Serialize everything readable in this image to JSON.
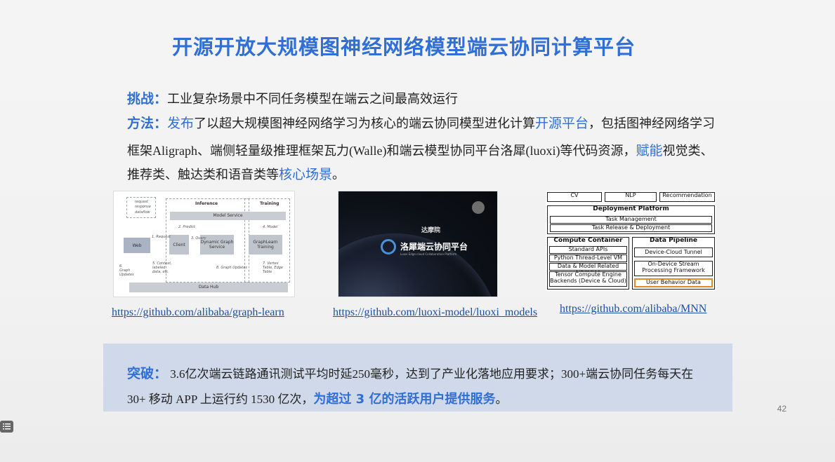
{
  "title": "开源开放大规模图神经网络模型端云协同计算平台",
  "challenge": {
    "label": "挑战：",
    "text": "工业复杂场景中不同任务模型在端云之间最高效运行"
  },
  "method": {
    "label": "方法：",
    "line1_a": "发布",
    "line1_b": "了以超大规模图神经网络学习为核心的端云协同模型进化计算",
    "line1_c": "开源平台",
    "line1_d": "，包括图神经网络学习",
    "line2_a": "框架Aligraph、端侧轻量级推理框架瓦力(Walle)和端云模型协同平台洛犀(luoxi)等代码资源，",
    "line2_b": "赋能",
    "line2_c": "视觉类、",
    "line3_a": "推荐类、触达类和语音类等",
    "line3_b": "核心场景",
    "line3_c": "。"
  },
  "figure1": {
    "inference": "Inference",
    "training": "Training",
    "model_service": "Model Service",
    "web": "Web",
    "client": "Client",
    "dynamic_graph": "Dynamic Graph Service",
    "graphlearn": "GraphLearn Training",
    "data_hub": "Data Hub",
    "request": "request",
    "response": "response",
    "dataflow": "dataflow",
    "s1": "1. Request",
    "s2": "2. Predict",
    "s3": "3. Query",
    "s4": "4. Model",
    "s5": "5. Context, labeled data, etc.",
    "s6": "6. Graph Updates",
    "s7": "7. Vertex Table, Edge Table",
    "s8": "8. Graph Updates"
  },
  "figure2": {
    "banner": "洛犀端云协同平台",
    "subtitle": "Luoxi Edge-cloud Collaboration Platform",
    "org": "达摩院"
  },
  "figure3": {
    "cv": "CV",
    "nlp": "NLP",
    "recommendation": "Recommendation",
    "deployment_platform": "Deployment Platform",
    "task_management": "Task Management",
    "task_release": "Task Release & Deployment",
    "compute_container": "Compute Container",
    "standard_apis": "Standard APIs",
    "python_vm": "Python Thread-Level VM",
    "libraries": "Data & Model Related Libraries",
    "tensor_engine": "Tensor Compute Engine Backends (Device & Cloud)",
    "data_pipeline": "Data Pipeline",
    "tunnel": "Device-Cloud Tunnel",
    "stream": "On-Device Stream Processing Framework",
    "ubd": "User Behavior Data"
  },
  "links": {
    "graph_learn": "https://github.com/alibaba/graph-learn",
    "luoxi": "https://github.com/luoxi-model/luoxi_models",
    "mnn": "https://github.com/alibaba/MNN"
  },
  "breakthrough": {
    "label": "突破：",
    "line1": "3.6亿次端云链路通讯测试平均时延250毫秒，达到了产业化落地应用要求；300+端云协同任务每天在",
    "line2_a": "30+ 移动 APP 上运行约 1530 亿次，",
    "line2_b": "为超过 3 亿的活跃用户提供服务",
    "line2_c": "。"
  },
  "page_number": "42"
}
